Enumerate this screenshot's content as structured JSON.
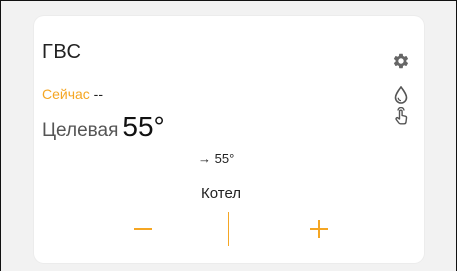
{
  "card": {
    "title": "ГВС",
    "now_label": "Сейчас",
    "now_value": " --",
    "target_label": "Целевая",
    "target_value": "55°",
    "setpoint": "→ 55°",
    "source": "Котел"
  },
  "colors": {
    "accent": "#f5a623",
    "icon": "#666666"
  },
  "icons": [
    "gear-icon",
    "water-drop-icon",
    "touch-hand-icon",
    "minus-icon",
    "plus-icon"
  ]
}
